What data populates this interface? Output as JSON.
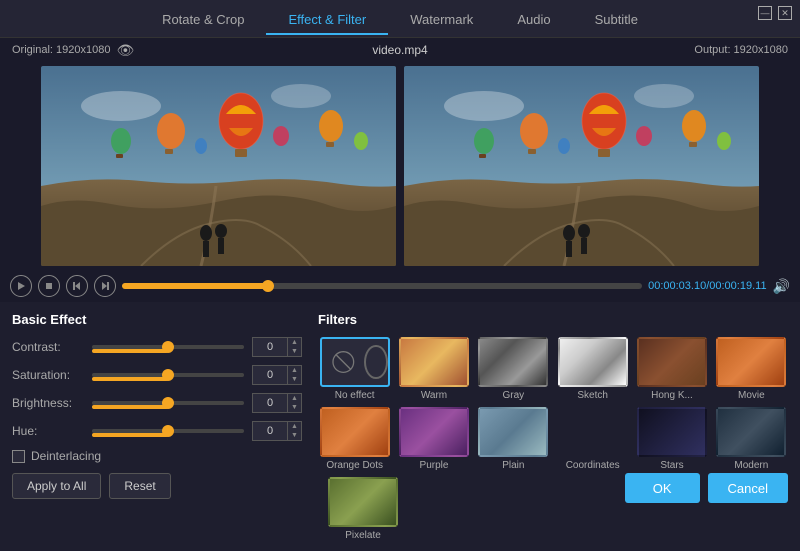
{
  "titlebar": {
    "minimize_label": "—",
    "close_label": "✕"
  },
  "tabs": [
    {
      "id": "rotate",
      "label": "Rotate & Crop"
    },
    {
      "id": "effect",
      "label": "Effect & Filter",
      "active": true
    },
    {
      "id": "watermark",
      "label": "Watermark"
    },
    {
      "id": "audio",
      "label": "Audio"
    },
    {
      "id": "subtitle",
      "label": "Subtitle"
    }
  ],
  "video": {
    "original_label": "Original: 1920x1080",
    "filename": "video.mp4",
    "output_label": "Output: 1920x1080",
    "time_current": "00:00:03.10",
    "time_total": "00:00:19.11",
    "time_separator": "/"
  },
  "basic_effect": {
    "title": "Basic Effect",
    "contrast_label": "Contrast:",
    "contrast_value": "0",
    "saturation_label": "Saturation:",
    "saturation_value": "0",
    "brightness_label": "Brightness:",
    "brightness_value": "0",
    "hue_label": "Hue:",
    "hue_value": "0",
    "deinterlacing_label": "Deinterlacing",
    "apply_label": "Apply to All",
    "reset_label": "Reset"
  },
  "filters": {
    "title": "Filters",
    "items": [
      {
        "id": "no-effect",
        "label": "No effect",
        "selected": true
      },
      {
        "id": "warm",
        "label": "Warm"
      },
      {
        "id": "gray",
        "label": "Gray"
      },
      {
        "id": "sketch",
        "label": "Sketch"
      },
      {
        "id": "hongkong",
        "label": "Hong K..."
      },
      {
        "id": "movie",
        "label": "Movie"
      },
      {
        "id": "orange-dots",
        "label": "Orange Dots"
      },
      {
        "id": "purple",
        "label": "Purple"
      },
      {
        "id": "plain",
        "label": "Plain"
      },
      {
        "id": "coordinates",
        "label": "Coordinates"
      },
      {
        "id": "stars",
        "label": "Stars"
      },
      {
        "id": "modern",
        "label": "Modern"
      },
      {
        "id": "pixelate",
        "label": "Pixelate"
      }
    ]
  },
  "actions": {
    "ok_label": "OK",
    "cancel_label": "Cancel"
  }
}
